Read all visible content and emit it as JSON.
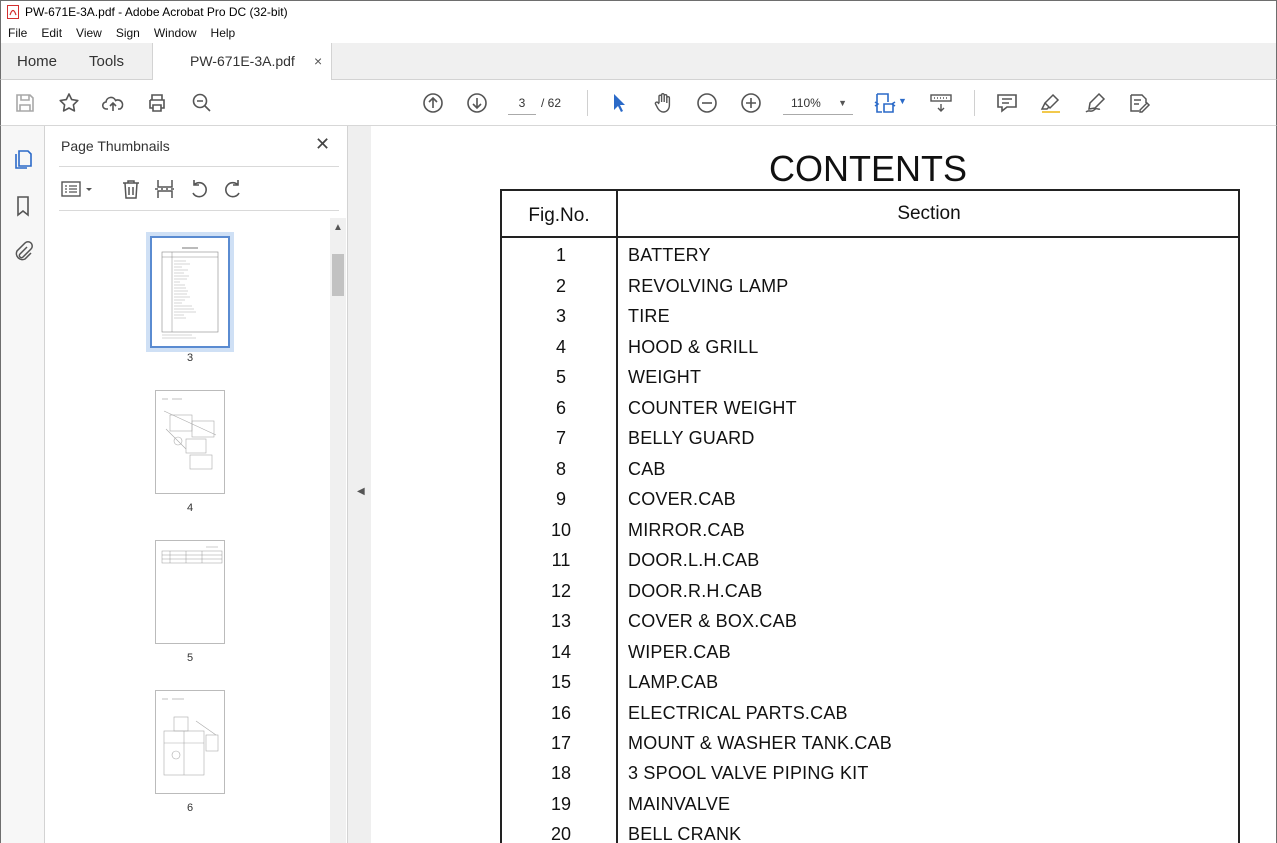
{
  "window": {
    "title": "PW-671E-3A.pdf - Adobe Acrobat Pro DC (32-bit)"
  },
  "menu": [
    "File",
    "Edit",
    "View",
    "Sign",
    "Window",
    "Help"
  ],
  "tabs": {
    "home": "Home",
    "tools": "Tools",
    "document": "PW-671E-3A.pdf",
    "close": "×"
  },
  "toolbar": {
    "page_current": "3",
    "page_total": "/ 62",
    "zoom": "110%",
    "icons": [
      "save-icon",
      "star-icon",
      "upload-icon",
      "print-icon",
      "zoom-search-icon",
      "page-up-icon",
      "page-down-icon",
      "select-cursor-icon",
      "hand-icon",
      "zoom-out-icon",
      "zoom-in-icon",
      "zoom-caret-icon",
      "page-fit-icon",
      "scroll-mode-icon",
      "comment-icon",
      "highlight-icon",
      "sign-icon",
      "fill-sign-icon"
    ]
  },
  "left_rail": {
    "icons": [
      "page-thumbnails-icon",
      "bookmark-icon",
      "attachment-icon"
    ]
  },
  "thumbnails_panel": {
    "title": "Page Thumbnails",
    "close": "✕",
    "pages": [
      {
        "label": "3",
        "selected": true
      },
      {
        "label": "4",
        "selected": false
      },
      {
        "label": "5",
        "selected": false
      },
      {
        "label": "6",
        "selected": false
      }
    ]
  },
  "document": {
    "title": "CONTENTS",
    "header_fig": "Fig.No.",
    "header_section": "Section",
    "rows": [
      {
        "fig": "1",
        "section": "BATTERY"
      },
      {
        "fig": "2",
        "section": "REVOLVING LAMP"
      },
      {
        "fig": "3",
        "section": "TIRE"
      },
      {
        "fig": "4",
        "section": "HOOD & GRILL"
      },
      {
        "fig": "5",
        "section": "WEIGHT"
      },
      {
        "fig": "6",
        "section": "COUNTER WEIGHT"
      },
      {
        "fig": "7",
        "section": "BELLY GUARD"
      },
      {
        "fig": "8",
        "section": "CAB"
      },
      {
        "fig": "9",
        "section": "COVER.CAB"
      },
      {
        "fig": "10",
        "section": "MIRROR.CAB"
      },
      {
        "fig": "11",
        "section": "DOOR.L.H.CAB"
      },
      {
        "fig": "12",
        "section": "DOOR.R.H.CAB"
      },
      {
        "fig": "13",
        "section": "COVER & BOX.CAB"
      },
      {
        "fig": "14",
        "section": "WIPER.CAB"
      },
      {
        "fig": "15",
        "section": "LAMP.CAB"
      },
      {
        "fig": "16",
        "section": "ELECTRICAL PARTS.CAB"
      },
      {
        "fig": "17",
        "section": "MOUNT & WASHER TANK.CAB"
      },
      {
        "fig": "18",
        "section": "3 SPOOL VALVE PIPING KIT"
      },
      {
        "fig": "19",
        "section": "MAINVALVE"
      },
      {
        "fig": "20",
        "section": "BELL CRANK"
      }
    ]
  },
  "colors": {
    "accent_blue": "#2b6ac8",
    "pdf_red": "#d32f2f",
    "selection_blue": "#5a8bd1"
  }
}
